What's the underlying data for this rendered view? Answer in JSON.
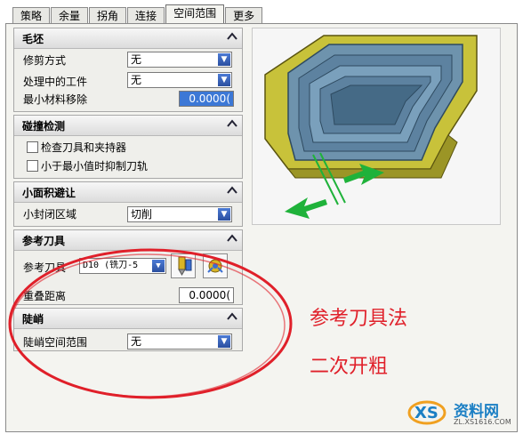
{
  "tabs": [
    "策略",
    "余量",
    "拐角",
    "连接",
    "空间范围",
    "更多"
  ],
  "active_tab": "空间范围",
  "sections": {
    "blank": {
      "title": "毛坯",
      "trim_label": "修剪方式",
      "trim_value": "无",
      "ipw_label": "处理中的工件",
      "ipw_value": "无",
      "min_removal_label": "最小材料移除",
      "min_removal_value": "0.0000("
    },
    "collision": {
      "title": "碰撞检测",
      "check_holder_label": "检查刀具和夹持器",
      "suppress_label": "小于最小值时抑制刀轨"
    },
    "small_area": {
      "title": "小面积避让",
      "small_closed_label": "小封闭区域",
      "small_closed_value": "切削"
    },
    "reference_tool": {
      "title": "参考刀具",
      "tool_label": "参考刀具",
      "tool_value": "D10 (铣刀-5",
      "overlap_label": "重叠距离",
      "overlap_value": "0.0000("
    },
    "steep": {
      "title": "陡峭",
      "steep_range_label": "陡峭空间范围",
      "steep_range_value": "无"
    }
  },
  "annotation": {
    "line1": "参考刀具法",
    "line2": "二次开粗"
  },
  "watermark": {
    "brand": "资料网",
    "url": "ZL.XS1616.COM"
  },
  "icons": {
    "collapse": "chevron-up-icon",
    "dropdown": "chevron-down-icon",
    "edit_tool": "edit-tool-icon",
    "display_tool": "display-tool-icon"
  },
  "colors": {
    "annotation_red": "#e0202a",
    "highlight_blue": "#3c78d6",
    "part_yellow": "#c8c23a",
    "part_blue": "#6e93ad",
    "arrow_green": "#1fb23a"
  }
}
